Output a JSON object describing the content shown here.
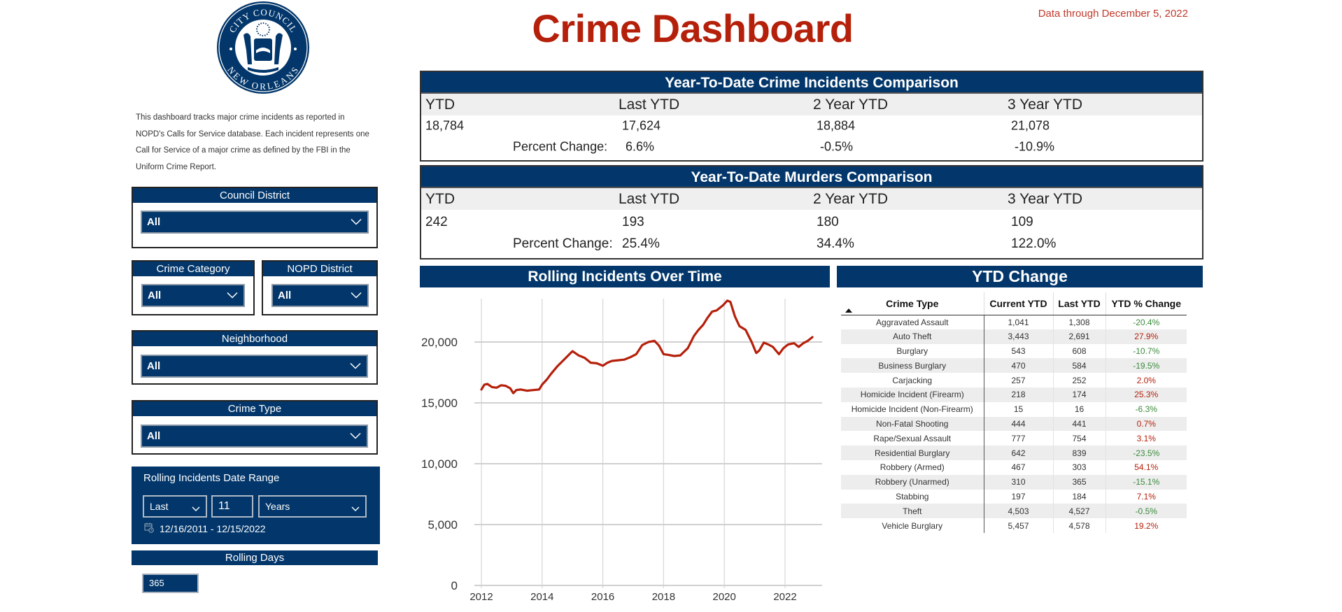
{
  "header": {
    "title": "Crime Dashboard",
    "data_through": "Data through December 5, 2022",
    "seal": {
      "top_text": "CITY COUNCIL",
      "bottom_text": "NEW ORLEANS"
    }
  },
  "description": "This dashboard tracks major crime incidents as reported in NOPD's Calls for Service database. Each incident represents one Call for Service of a major crime as defined by the FBI in the Uniform Crime Report.",
  "filters": {
    "council_district": {
      "label": "Council District",
      "value": "All"
    },
    "crime_category": {
      "label": "Crime Category",
      "value": "All"
    },
    "nopd_district": {
      "label": "NOPD District",
      "value": "All"
    },
    "neighborhood": {
      "label": "Neighborhood",
      "value": "All"
    },
    "crime_type": {
      "label": "Crime Type",
      "value": "All"
    }
  },
  "date_range": {
    "title": "Rolling Incidents Date Range",
    "relative": "Last",
    "count": "11",
    "unit": "Years",
    "range_text": "12/16/2011 - 12/15/2022",
    "icon": "calendar-icon"
  },
  "rolling_days": {
    "label": "Rolling Days",
    "value": "365"
  },
  "incidents_comparison": {
    "title": "Year-To-Date Crime Incidents Comparison",
    "columns": [
      "YTD",
      "Last YTD",
      "2 Year YTD",
      "3 Year YTD"
    ],
    "values": [
      "18,784",
      "17,624",
      "18,884",
      "21,078"
    ],
    "percent_label": "Percent Change:",
    "percent_changes": [
      "6.6%",
      "-0.5%",
      "-10.9%"
    ]
  },
  "murders_comparison": {
    "title": "Year-To-Date Murders Comparison",
    "columns": [
      "YTD",
      "Last YTD",
      "2 Year YTD",
      "3 Year YTD"
    ],
    "values": [
      "242",
      "193",
      "180",
      "109"
    ],
    "percent_label": "Percent Change:",
    "percent_changes": [
      "25.4%",
      "34.4%",
      "122.0%"
    ]
  },
  "chart_data": {
    "type": "line",
    "title": "Rolling Incidents Over Time",
    "xlabel": "",
    "ylabel": "",
    "xlim": [
      2011.95,
      2023.2
    ],
    "ylim": [
      0,
      23600
    ],
    "x_ticks": [
      2012,
      2014,
      2016,
      2018,
      2020,
      2022
    ],
    "y_ticks": [
      0,
      5000,
      10000,
      15000,
      20000
    ],
    "y_tick_labels": [
      "0",
      "5,000",
      "10,000",
      "15,000",
      "20,000"
    ],
    "grid": true,
    "color": "#b5200b",
    "series": [
      {
        "name": "Rolling Incidents",
        "x": [
          2012.0,
          2012.1,
          2012.2,
          2012.35,
          2012.5,
          2012.65,
          2012.8,
          2012.95,
          2013.05,
          2013.15,
          2013.3,
          2013.5,
          2013.7,
          2013.9,
          2014.0,
          2014.15,
          2014.3,
          2014.5,
          2014.7,
          2014.9,
          2015.0,
          2015.2,
          2015.4,
          2015.6,
          2015.8,
          2016.0,
          2016.15,
          2016.3,
          2016.5,
          2016.7,
          2016.9,
          2017.1,
          2017.3,
          2017.5,
          2017.7,
          2017.85,
          2018.0,
          2018.15,
          2018.35,
          2018.55,
          2018.8,
          2019.0,
          2019.15,
          2019.3,
          2019.45,
          2019.6,
          2019.75,
          2019.95,
          2020.1,
          2020.2,
          2020.35,
          2020.5,
          2020.7,
          2020.9,
          2021.05,
          2021.15,
          2021.3,
          2021.45,
          2021.6,
          2021.8,
          2021.95,
          2022.1,
          2022.3,
          2022.45,
          2022.6,
          2022.75,
          2022.9
        ],
        "y": [
          16100,
          16500,
          16550,
          16300,
          16250,
          16450,
          16400,
          16200,
          15800,
          16050,
          16100,
          16000,
          16050,
          16100,
          16500,
          16900,
          17400,
          18000,
          18500,
          19000,
          19250,
          18900,
          18700,
          18300,
          18250,
          18050,
          18300,
          18450,
          18500,
          18550,
          18750,
          19000,
          19750,
          20000,
          20100,
          19700,
          19000,
          18950,
          18850,
          18900,
          19500,
          20500,
          21000,
          21400,
          22000,
          22500,
          22600,
          23000,
          23400,
          23300,
          22100,
          21300,
          21000,
          20000,
          19100,
          19300,
          19950,
          19800,
          19600,
          19000,
          19500,
          19800,
          19900,
          19600,
          19900,
          20100,
          20400
        ]
      }
    ]
  },
  "ytd_change": {
    "title": "YTD Change",
    "columns": [
      "Crime Type",
      "Current YTD",
      "Last YTD",
      "YTD % Change"
    ],
    "sort_icon": "sort-ascending-icon",
    "rows": [
      {
        "type": "Aggravated Assault",
        "current": "1,041",
        "last": "1,308",
        "change": "-20.4%"
      },
      {
        "type": "Auto Theft",
        "current": "3,443",
        "last": "2,691",
        "change": "27.9%"
      },
      {
        "type": "Burglary",
        "current": "543",
        "last": "608",
        "change": "-10.7%"
      },
      {
        "type": "Business Burglary",
        "current": "470",
        "last": "584",
        "change": "-19.5%"
      },
      {
        "type": "Carjacking",
        "current": "257",
        "last": "252",
        "change": "2.0%"
      },
      {
        "type": "Homicide Incident (Firearm)",
        "current": "218",
        "last": "174",
        "change": "25.3%"
      },
      {
        "type": "Homicide Incident (Non-Firearm)",
        "current": "15",
        "last": "16",
        "change": "-6.3%"
      },
      {
        "type": "Non-Fatal Shooting",
        "current": "444",
        "last": "441",
        "change": "0.7%"
      },
      {
        "type": "Rape/Sexual Assault",
        "current": "777",
        "last": "754",
        "change": "3.1%"
      },
      {
        "type": "Residential Burglary",
        "current": "642",
        "last": "839",
        "change": "-23.5%"
      },
      {
        "type": "Robbery (Armed)",
        "current": "467",
        "last": "303",
        "change": "54.1%"
      },
      {
        "type": "Robbery (Unarmed)",
        "current": "310",
        "last": "365",
        "change": "-15.1%"
      },
      {
        "type": "Stabbing",
        "current": "197",
        "last": "184",
        "change": "7.1%"
      },
      {
        "type": "Theft",
        "current": "4,503",
        "last": "4,527",
        "change": "-0.5%"
      },
      {
        "type": "Vehicle Burglary",
        "current": "5,457",
        "last": "4,578",
        "change": "19.2%"
      }
    ]
  },
  "colors": {
    "navy": "#03376b",
    "title_red": "#b5200b",
    "decrease_green": "#3a8a3a",
    "increase_red": "#b5200b"
  }
}
